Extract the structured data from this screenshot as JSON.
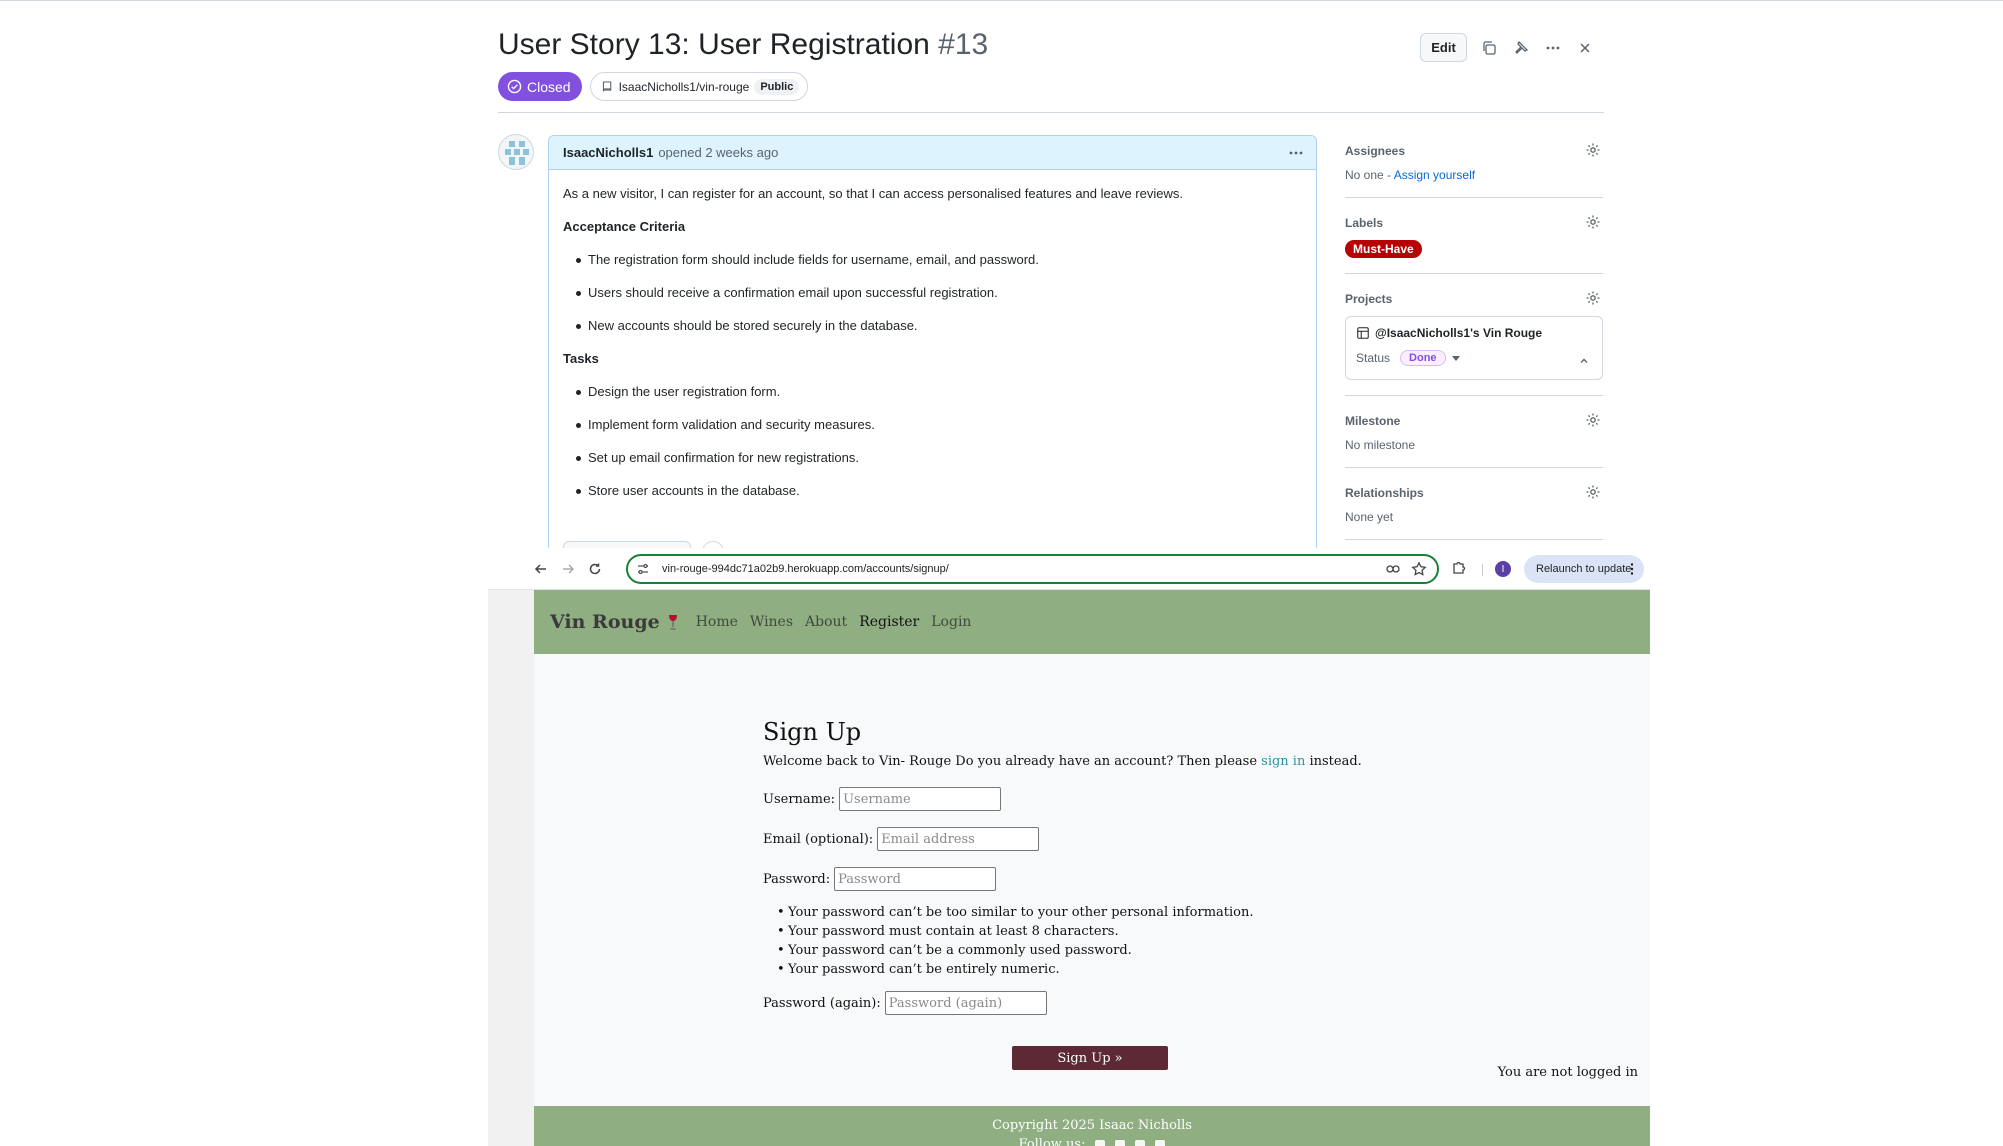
{
  "issue": {
    "title": "User Story 13: User Registration",
    "number": "#13",
    "state": "Closed",
    "repo": "IsaacNicholls1/vin-rouge",
    "visibility": "Public",
    "edit_label": "Edit",
    "author": "IsaacNicholls1",
    "opened_meta": "opened 2 weeks ago",
    "intro": "As a new visitor, I can register for an account, so that I can access personalised features and leave reviews.",
    "criteria_heading": "Acceptance Criteria",
    "criteria": [
      "The registration form should include fields for username, email, and password.",
      "Users should receive a confirmation email upon successful registration.",
      "New accounts should be stored securely in the database."
    ],
    "tasks_heading": "Tasks",
    "tasks": [
      "Design the user registration form.",
      "Implement form validation and security measures.",
      "Set up email confirmation for new registrations.",
      "Store user accounts in the database."
    ]
  },
  "sidebar": {
    "assignees_title": "Assignees",
    "assignees_none": "No one - ",
    "assign_yourself": "Assign yourself",
    "labels_title": "Labels",
    "label": "Must-Have",
    "label_color": "#b60205",
    "projects_title": "Projects",
    "project_name": "@IsaacNicholls1's Vin Rouge",
    "status_label": "Status",
    "status_value": "Done",
    "milestone_title": "Milestone",
    "milestone_value": "No milestone",
    "relationships_title": "Relationships",
    "relationships_value": "None yet"
  },
  "browser": {
    "url": "vin-rouge-994dc71a02b9.herokuapp.com/accounts/signup/",
    "profile_initial": "I",
    "relaunch_label": "Relaunch to update"
  },
  "site": {
    "brand": "Vin Rouge",
    "nav": [
      "Home",
      "Wines",
      "About",
      "Register",
      "Login"
    ],
    "heading": "Sign Up",
    "welcome_pre": "Welcome back to Vin- Rouge Do you already have an account? Then please ",
    "sign_in_link": "sign in",
    "welcome_post": " instead.",
    "username_label": "Username:",
    "username_placeholder": "Username",
    "email_label": "Email (optional):",
    "email_placeholder": "Email address",
    "password_label": "Password:",
    "password_placeholder": "Password",
    "password_help": [
      "Your password can’t be too similar to your other personal information.",
      "Your password must contain at least 8 characters.",
      "Your password can’t be a commonly used password.",
      "Your password can’t be entirely numeric."
    ],
    "password2_label": "Password (again):",
    "password2_placeholder": "Password (again)",
    "submit_label": "Sign Up »",
    "login_status": "You are not logged in",
    "copyright": "Copyright 2025 Isaac Nicholls",
    "follow": "Follow us:",
    "nav_color": "#8fae82",
    "button_color": "#5c2935"
  }
}
